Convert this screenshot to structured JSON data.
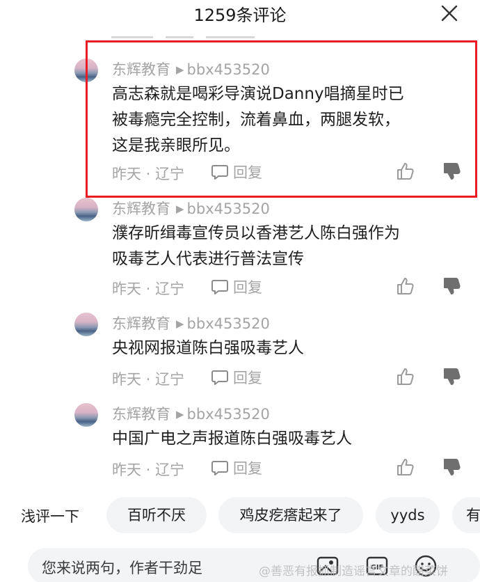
{
  "header": {
    "title": "1259条评论",
    "close_icon": "close-icon"
  },
  "comments": [
    {
      "author": "东辉教育",
      "reply_to": "bbx453520",
      "text_lines": [
        "高志森就是喝彩导演说Danny唱摘星时已",
        "被毒瘾完全控制，流着鼻血，两腿发软，",
        "这是我亲眼所见。"
      ],
      "time_location": "昨天 · 辽宁",
      "reply_label": "回复"
    },
    {
      "author": "东辉教育",
      "reply_to": "bbx453520",
      "text_lines": [
        "濮存昕缉毒宣传员以香港艺人陈白强作为",
        "吸毒艺人代表进行普法宣传"
      ],
      "time_location": "昨天 · 辽宁",
      "reply_label": "回复"
    },
    {
      "author": "东辉教育",
      "reply_to": "bbx453520",
      "text_lines": [
        "央视网报道陈白强吸毒艺人"
      ],
      "time_location": "昨天 · 辽宁",
      "reply_label": "回复"
    },
    {
      "author": "东辉教育",
      "reply_to": "bbx453520",
      "text_lines": [
        "中国广电之声报道陈白强吸毒艺人"
      ],
      "time_location": "昨天 · 辽宁",
      "reply_label": "回复"
    }
  ],
  "quick_comments": {
    "lead": "浅评一下",
    "chips": [
      "百听不厌",
      "鸡皮疙瘩起来了",
      "yyds",
      "有"
    ]
  },
  "input": {
    "placeholder": "您来说两句，作者干劲足"
  },
  "watermark": "@善恶有报抓制造谣言文章的醋菜饼",
  "colors": {
    "highlight_border": "#ea1b23",
    "meta_text": "#a4a4a4",
    "chip_bg": "#f3f4f6"
  }
}
